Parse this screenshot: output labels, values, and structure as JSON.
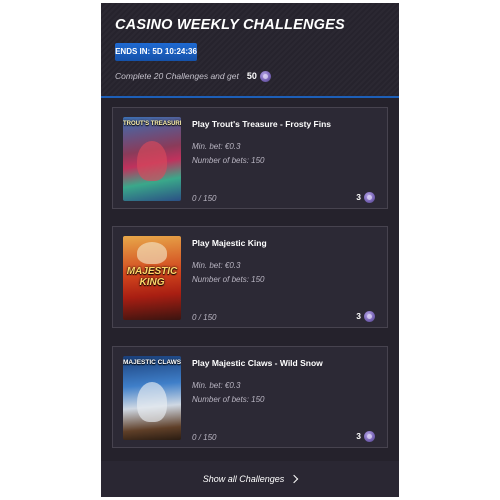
{
  "header": {
    "title": "CASINO WEEKLY CHALLENGES",
    "ends_badge": "ENDS IN: 5D 10:24:36",
    "complete_text": "Complete 20 Challenges and get",
    "complete_points": "50",
    "points_icon": "purple-coin-icon"
  },
  "challenges": [
    {
      "title": "Play Trout's Treasure - Frosty Fins",
      "thumb_label": "TROUT'S TREASURE FROSTY FINS",
      "min_bet": "Min. bet: €0.3",
      "num_bets": "Number of bets: 150",
      "progress": "0 / 150",
      "reward": "3"
    },
    {
      "title": "Play Majestic King",
      "thumb_label": "MAJESTIC KING",
      "min_bet": "Min. bet: €0.3",
      "num_bets": "Number of bets: 150",
      "progress": "0 / 150",
      "reward": "3"
    },
    {
      "title": "Play Majestic Claws - Wild Snow",
      "thumb_label": "MAJESTIC CLAWS WILD SNOW",
      "min_bet": "Min. bet: €0.3",
      "num_bets": "Number of bets: 150",
      "progress": "0 / 150",
      "reward": "3"
    }
  ],
  "footer": {
    "show_all": "Show all Challenges"
  },
  "colors": {
    "panel_bg": "#25222c",
    "card_bg": "#2c2935",
    "accent_blue": "#1d5fb8",
    "coin_purple": "#7a66b8"
  }
}
